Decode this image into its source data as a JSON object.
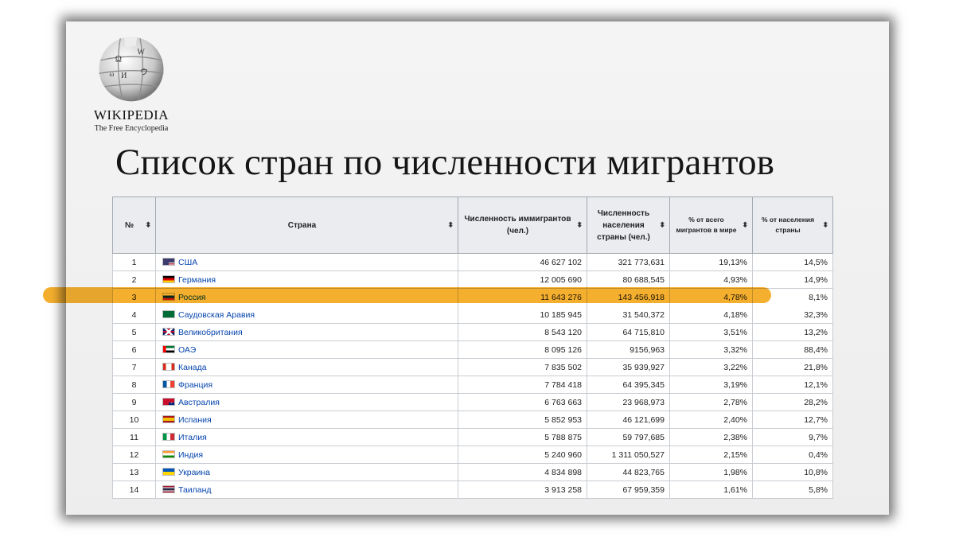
{
  "logo": {
    "wordmark": "WIKIPEDIA",
    "tagline": "The Free Encyclopedia"
  },
  "title": "Список стран по численности мигрантов",
  "colors": {
    "highlight": "#f5a81c",
    "link": "#0645ad",
    "header_bg": "#eaecf0"
  },
  "sort_icon": "sort-arrows-icon",
  "table": {
    "headers": [
      "№",
      "Страна",
      "Численность иммигрантов (чел.)",
      "Численность населения страны (чел.)",
      "% от всего мигрантов в мире",
      "% от населения страны"
    ],
    "rows": [
      {
        "rank": "1",
        "country": "США",
        "flag": "us",
        "immigrants": "46 627 102",
        "population": "321 773,631",
        "pct_world": "19,13%",
        "pct_country": "14,5%"
      },
      {
        "rank": "2",
        "country": "Германия",
        "flag": "de",
        "immigrants": "12 005 690",
        "population": "80 688,545",
        "pct_world": "4,93%",
        "pct_country": "14,9%"
      },
      {
        "rank": "3",
        "country": "Россия",
        "flag": "ru",
        "immigrants": "11 643 276",
        "population": "143 456,918",
        "pct_world": "4,78%",
        "pct_country": "8,1%",
        "highlight": true
      },
      {
        "rank": "4",
        "country": "Саудовская Аравия",
        "flag": "sa",
        "immigrants": "10 185 945",
        "population": "31 540,372",
        "pct_world": "4,18%",
        "pct_country": "32,3%"
      },
      {
        "rank": "5",
        "country": "Великобритания",
        "flag": "gb",
        "immigrants": "8 543 120",
        "population": "64 715,810",
        "pct_world": "3,51%",
        "pct_country": "13,2%"
      },
      {
        "rank": "6",
        "country": "ОАЭ",
        "flag": "ae",
        "immigrants": "8 095 126",
        "population": "9156,963",
        "pct_world": "3,32%",
        "pct_country": "88,4%"
      },
      {
        "rank": "7",
        "country": "Канада",
        "flag": "ca",
        "immigrants": "7 835 502",
        "population": "35 939,927",
        "pct_world": "3,22%",
        "pct_country": "21,8%"
      },
      {
        "rank": "8",
        "country": "Франция",
        "flag": "fr",
        "immigrants": "7 784 418",
        "population": "64 395,345",
        "pct_world": "3,19%",
        "pct_country": "12,1%"
      },
      {
        "rank": "9",
        "country": "Австралия",
        "flag": "au",
        "immigrants": "6 763 663",
        "population": "23 968,973",
        "pct_world": "2,78%",
        "pct_country": "28,2%"
      },
      {
        "rank": "10",
        "country": "Испания",
        "flag": "es",
        "immigrants": "5 852 953",
        "population": "46 121,699",
        "pct_world": "2,40%",
        "pct_country": "12,7%"
      },
      {
        "rank": "11",
        "country": "Италия",
        "flag": "it",
        "immigrants": "5 788 875",
        "population": "59 797,685",
        "pct_world": "2,38%",
        "pct_country": "9,7%"
      },
      {
        "rank": "12",
        "country": "Индия",
        "flag": "in",
        "immigrants": "5 240 960",
        "population": "1 311 050,527",
        "pct_world": "2,15%",
        "pct_country": "0,4%"
      },
      {
        "rank": "13",
        "country": "Украина",
        "flag": "ua",
        "immigrants": "4 834 898",
        "population": "44 823,765",
        "pct_world": "1,98%",
        "pct_country": "10,8%"
      },
      {
        "rank": "14",
        "country": "Таиланд",
        "flag": "th",
        "immigrants": "3 913 258",
        "population": "67 959,359",
        "pct_world": "1,61%",
        "pct_country": "5,8%"
      }
    ]
  }
}
